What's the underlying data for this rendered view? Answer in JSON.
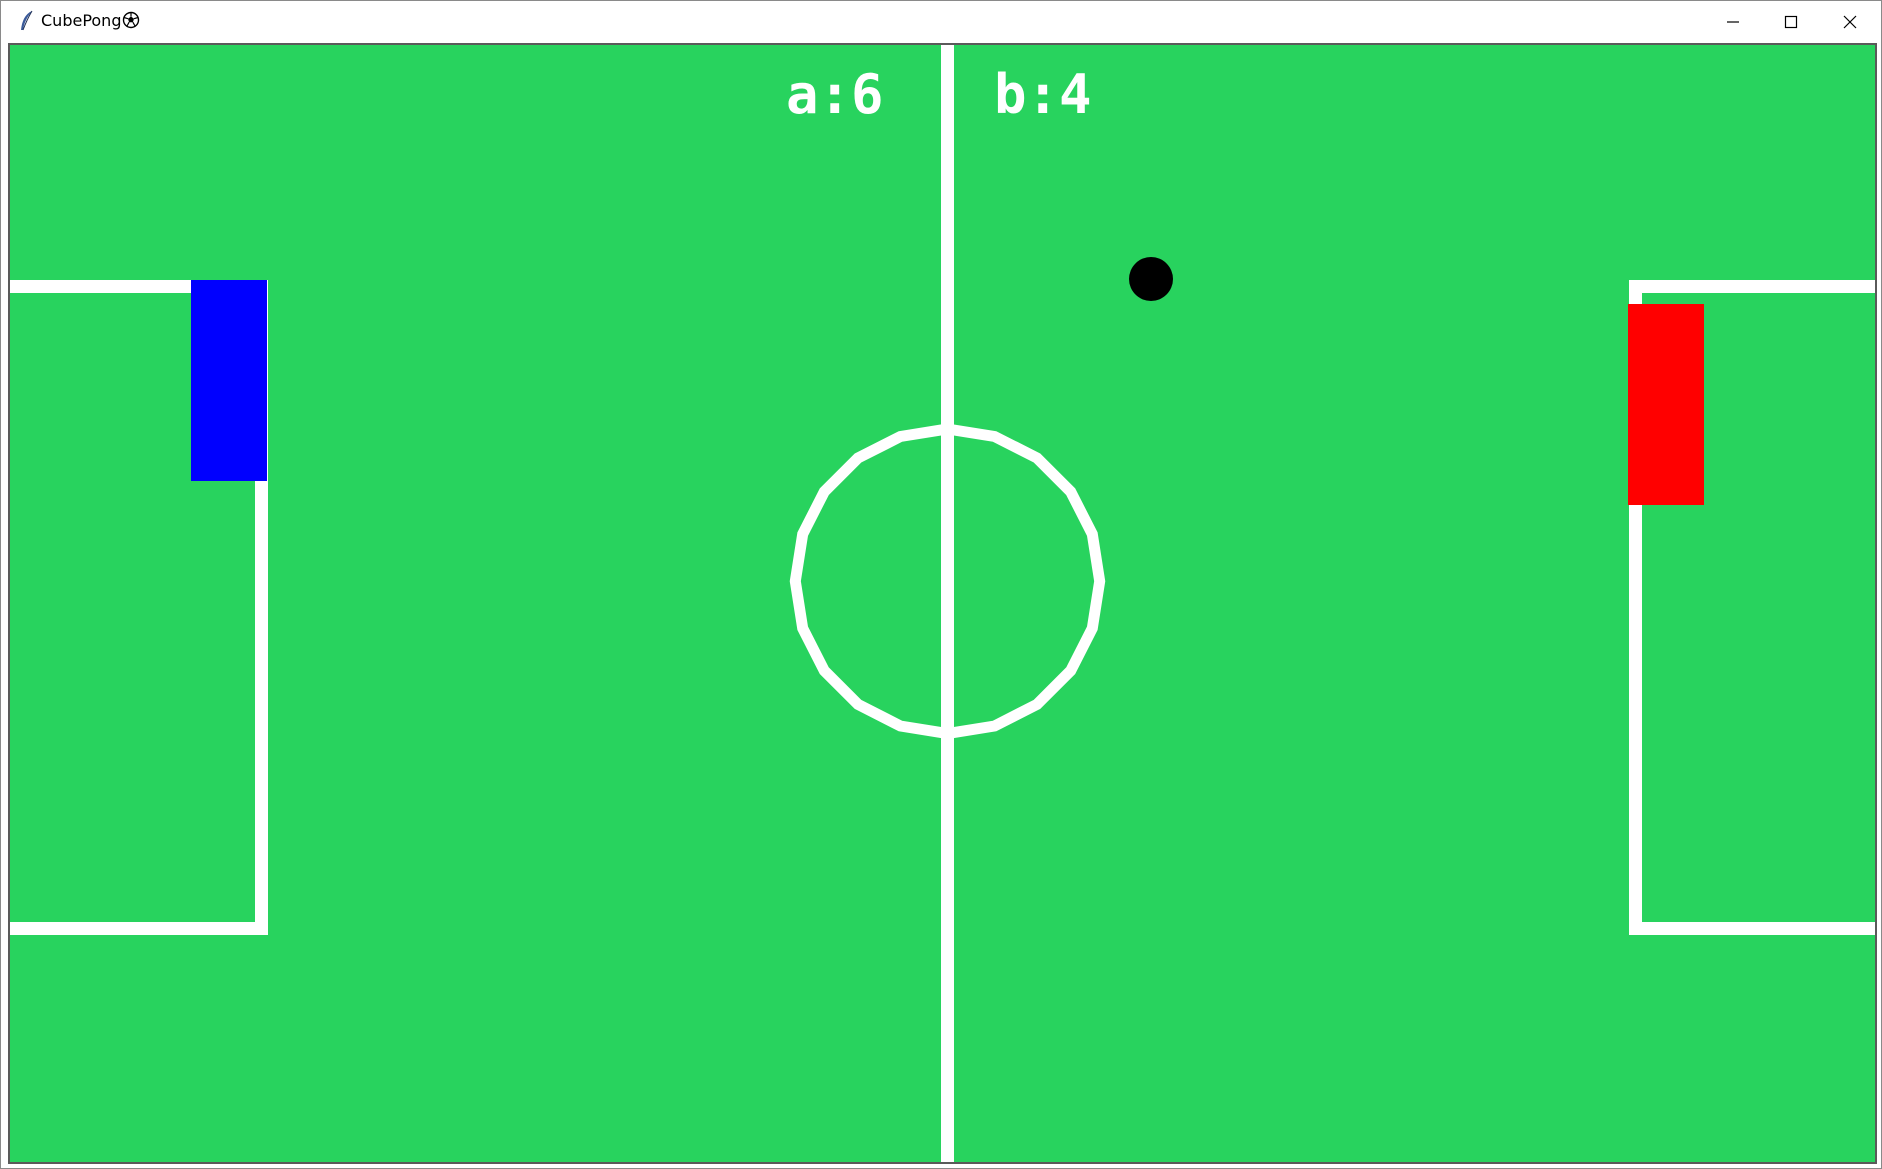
{
  "window": {
    "title": "CubePong",
    "title_icon": "soccer-ball-icon",
    "app_icon": "feather-icon",
    "controls": [
      "minimize-icon",
      "maximize-icon",
      "close-icon"
    ]
  },
  "game": {
    "score_a": "a:6",
    "score_b": "b:4",
    "colors": {
      "field": "#28d35e",
      "lines": "#ffffff",
      "paddle_a": "#0000ff",
      "paddle_b": "#ff0000",
      "ball": "#000000"
    }
  }
}
